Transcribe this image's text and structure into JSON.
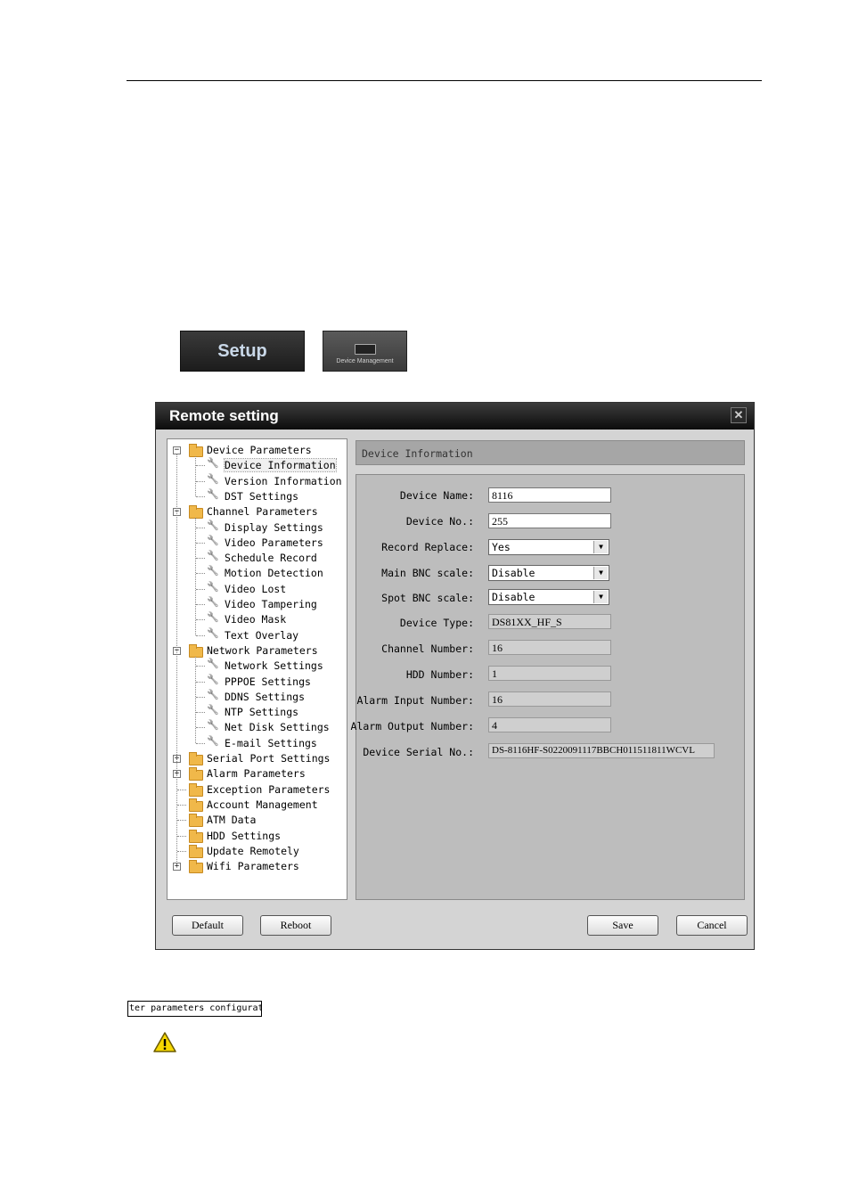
{
  "toolbar": {
    "setup_label": "Setup",
    "device_management_label": "Device Management"
  },
  "window": {
    "title": "Remote setting",
    "close_glyph": "✕"
  },
  "tree": [
    {
      "label": "Device Parameters",
      "level": 0,
      "expander": "−"
    },
    {
      "label": "Device Information",
      "level": 1,
      "selected": true
    },
    {
      "label": "Version Information",
      "level": 1
    },
    {
      "label": "DST Settings",
      "level": 1
    },
    {
      "label": "Channel Parameters",
      "level": 0,
      "expander": "−"
    },
    {
      "label": "Display Settings",
      "level": 1
    },
    {
      "label": "Video Parameters",
      "level": 1
    },
    {
      "label": "Schedule Record",
      "level": 1
    },
    {
      "label": "Motion Detection",
      "level": 1
    },
    {
      "label": "Video Lost",
      "level": 1
    },
    {
      "label": "Video Tampering",
      "level": 1
    },
    {
      "label": "Video Mask",
      "level": 1
    },
    {
      "label": "Text Overlay",
      "level": 1
    },
    {
      "label": "Network Parameters",
      "level": 0,
      "expander": "−"
    },
    {
      "label": "Network Settings",
      "level": 1
    },
    {
      "label": "PPPOE Settings",
      "level": 1
    },
    {
      "label": "DDNS Settings",
      "level": 1
    },
    {
      "label": "NTP Settings",
      "level": 1
    },
    {
      "label": "Net Disk Settings",
      "level": 1
    },
    {
      "label": "E-mail Settings",
      "level": 1
    },
    {
      "label": "Serial Port Settings",
      "level": 0,
      "expander": "+"
    },
    {
      "label": "Alarm Parameters",
      "level": 0,
      "expander": "+"
    },
    {
      "label": "Exception Parameters",
      "level": 0
    },
    {
      "label": "Account Management",
      "level": 0
    },
    {
      "label": "ATM Data",
      "level": 0
    },
    {
      "label": "HDD Settings",
      "level": 0
    },
    {
      "label": "Update Remotely",
      "level": 0
    },
    {
      "label": "Wifi Parameters",
      "level": 0,
      "expander": "+"
    }
  ],
  "panel": {
    "title": "Device Information",
    "fields": {
      "device_name": {
        "label": "Device Name:",
        "value": "8116"
      },
      "device_no": {
        "label": "Device No.:",
        "value": "255"
      },
      "record_replace": {
        "label": "Record Replace:",
        "value": "Yes"
      },
      "main_bnc": {
        "label": "Main BNC scale:",
        "value": "Disable"
      },
      "spot_bnc": {
        "label": "Spot BNC scale:",
        "value": "Disable"
      },
      "device_type": {
        "label": "Device Type:",
        "value": "DS81XX_HF_S"
      },
      "channel_number": {
        "label": "Channel Number:",
        "value": "16"
      },
      "hdd_number": {
        "label": "HDD Number:",
        "value": "1"
      },
      "alarm_input": {
        "label": "Alarm Input Number:",
        "value": "16"
      },
      "alarm_output": {
        "label": "Alarm Output Number:",
        "value": "4"
      },
      "serial_no": {
        "label": "Device Serial No.:",
        "value": "DS-8116HF-S0220091117BBCH011511811WCVL"
      }
    }
  },
  "buttons": {
    "default": "Default",
    "reboot": "Reboot",
    "save": "Save",
    "cancel": "Cancel"
  },
  "caption": "ter parameters configurati",
  "colors": {
    "titlebar": "#0c0c0c",
    "panel_bg": "#bdbdbd",
    "folder": "#f0b84a"
  }
}
